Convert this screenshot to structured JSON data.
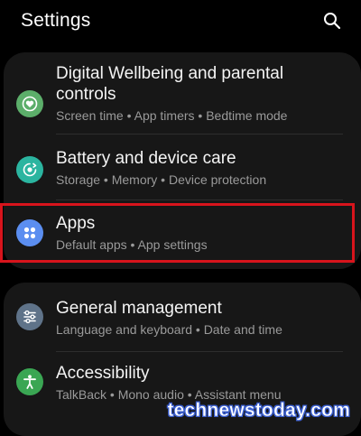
{
  "header": {
    "title": "Settings",
    "search_icon": "search-icon"
  },
  "groups": [
    {
      "items": [
        {
          "title": "Digital Wellbeing and parental controls",
          "title_line1": "Digital Wellbeing and parental",
          "title_line2": "controls",
          "subtitle": "Screen time  •  App timers  •  Bedtime mode",
          "icon": "wellbeing-heart-icon",
          "icon_color": "#5cae6a"
        },
        {
          "title": "Battery and device care",
          "subtitle": "Storage  •  Memory  •  Device protection",
          "icon": "device-care-icon",
          "icon_color": "#2bb5a0"
        },
        {
          "title": "Apps",
          "subtitle": "Default apps  •  App settings",
          "icon": "apps-grid-icon",
          "icon_color": "#5b8ef0",
          "highlighted": true
        }
      ]
    },
    {
      "items": [
        {
          "title": "General management",
          "subtitle": "Language and keyboard  •  Date and time",
          "icon": "sliders-icon",
          "icon_color": "#5f7389"
        },
        {
          "title": "Accessibility",
          "subtitle": "TalkBack  •  Mono audio  •  Assistant menu",
          "icon": "accessibility-person-icon",
          "icon_color": "#3aa653"
        }
      ]
    }
  ],
  "colors": {
    "background": "#000000",
    "card": "#171717",
    "highlight": "#d8141c",
    "subtitle": "#9a9a9a"
  },
  "watermark": "technewstoday.com"
}
